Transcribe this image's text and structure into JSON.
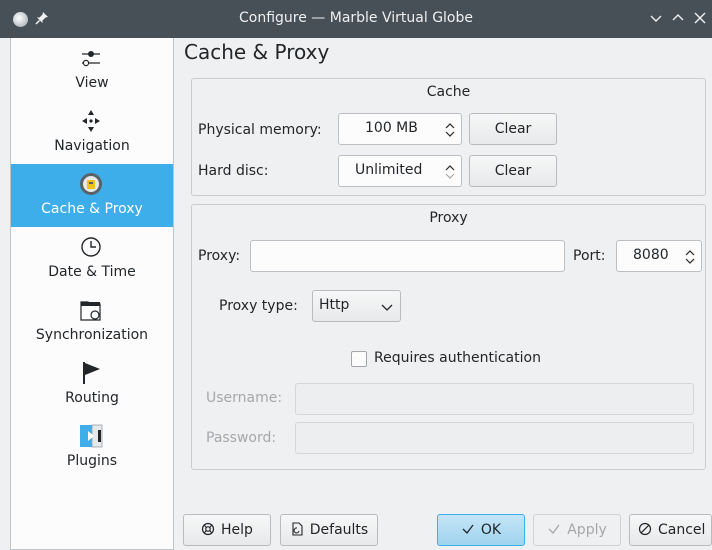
{
  "window": {
    "title": "Configure — Marble Virtual Globe",
    "app_icon": "globe-icon",
    "pin_icon": "pin-icon"
  },
  "sidebar": {
    "items": [
      {
        "label": "View",
        "icon": "view-sliders-icon",
        "active": false
      },
      {
        "label": "Navigation",
        "icon": "navigation-arrows-icon",
        "active": false
      },
      {
        "label": "Cache & Proxy",
        "icon": "cache-proxy-icon",
        "active": true
      },
      {
        "label": "Date & Time",
        "icon": "clock-icon",
        "active": false
      },
      {
        "label": "Synchronization",
        "icon": "folder-sync-icon",
        "active": false
      },
      {
        "label": "Routing",
        "icon": "flag-icon",
        "active": false
      },
      {
        "label": "Plugins",
        "icon": "plugins-icon",
        "active": false
      }
    ]
  },
  "page": {
    "title": "Cache & Proxy"
  },
  "cache": {
    "title": "Cache",
    "physical_label": "Physical memory:",
    "physical_value": "100 MB",
    "hard_label": "Hard disc:",
    "hard_value": "Unlimited",
    "clear_label": "Clear"
  },
  "proxy": {
    "title": "Proxy",
    "proxy_label": "Proxy:",
    "proxy_value": "",
    "port_label": "Port:",
    "port_value": "8080",
    "type_label": "Proxy type:",
    "type_value": "Http",
    "auth_label": "Requires authentication",
    "auth_checked": false,
    "username_label": "Username:",
    "password_label": "Password:"
  },
  "buttons": {
    "help": "Help",
    "defaults": "Defaults",
    "ok": "OK",
    "apply": "Apply",
    "cancel": "Cancel"
  },
  "colors": {
    "accent": "#3daee9",
    "titlebar": "#475057",
    "window_bg": "#eff0f1"
  }
}
